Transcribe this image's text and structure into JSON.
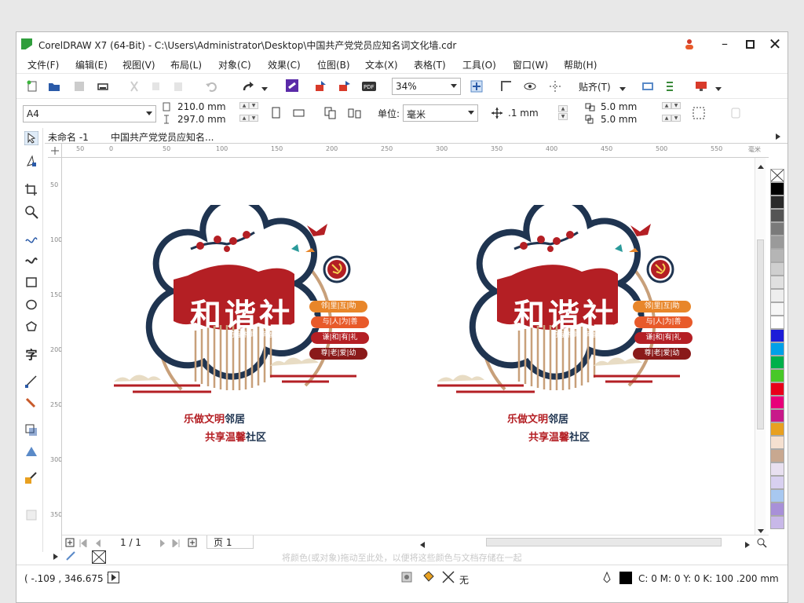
{
  "window": {
    "title": "CorelDRAW X7 (64-Bit) - C:\\Users\\Administrator\\Desktop\\中国共产党党员应知名词文化墙.cdr"
  },
  "menu": [
    "文件(F)",
    "编辑(E)",
    "视图(V)",
    "布局(L)",
    "对象(C)",
    "效果(C)",
    "位图(B)",
    "文本(X)",
    "表格(T)",
    "工具(O)",
    "窗口(W)",
    "帮助(H)"
  ],
  "toolbar": {
    "zoom": "34%",
    "snap_label": "贴齐(T)"
  },
  "property_bar": {
    "page_size": "A4",
    "width": "210.0 mm",
    "height": "297.0 mm",
    "units_label": "单位:",
    "units_value": "毫米",
    "nudge": ".1 mm",
    "dup_x": "5.0 mm",
    "dup_y": "5.0 mm"
  },
  "doc_tabs": [
    "未命名 -1",
    "中国共产党党员应知名..."
  ],
  "ruler": {
    "h_ticks": [
      "50",
      "0",
      "50",
      "100",
      "150",
      "200",
      "250",
      "300",
      "350",
      "400",
      "450",
      "500",
      "550"
    ],
    "h_unit": "毫米",
    "v_ticks": [
      "50",
      "100",
      "150",
      "200",
      "250",
      "300",
      "350"
    ]
  },
  "design": {
    "main_title": "和谐社区",
    "subtitle": "守望相助 幸福邻里",
    "tags": [
      "邻|里|互|助",
      "与|人|为|善",
      "谦|和|有|礼",
      "尊|老|爱|幼"
    ],
    "slogan1_a": "乐做文明",
    "slogan1_b": "邻居",
    "slogan2_a": "共享温馨",
    "slogan2_b": "社区",
    "colors": {
      "red": "#b41f24",
      "navy": "#1f3450",
      "orange": "#e8862a",
      "tan": "#c8a07a"
    }
  },
  "page_nav": {
    "counter": "1 / 1",
    "page_tab": "页 1"
  },
  "hint_text": "将颜色(或对象)拖动至此处，以便将这些颜色与文档存储在一起",
  "status": {
    "coords": "( -.109 , 346.675 )",
    "fill_label": "无",
    "outline_info": "C: 0 M: 0 Y: 0 K: 100  .200 mm"
  },
  "palette": [
    "#ffffff",
    "#000000",
    "#2a2a2a",
    "#555555",
    "#7a7a7a",
    "#9a9a9a",
    "#b5b5b5",
    "#cfcfcf",
    "#e0e0e0",
    "#eeeeee",
    "#f6f6f6",
    "#ffffff",
    "#1d1dd8",
    "#00a0e8",
    "#00b04a",
    "#48c828",
    "#e8001a",
    "#e8007a",
    "#c81a8a",
    "#e8a020",
    "#f5e0d0",
    "#c8a890",
    "#e8e0f0",
    "#d8d0f0",
    "#a8c8f0",
    "#a890d8",
    "#c8b8e8"
  ],
  "icons": [
    "app-icon",
    "user-icon",
    "minimize-icon",
    "maximize-icon",
    "close-icon",
    "new-doc-icon",
    "open-icon",
    "save-icon",
    "print-icon",
    "undo-icon",
    "redo-icon",
    "import-icon",
    "export-icon",
    "pdf-icon",
    "pick-tool-icon",
    "shape-tool-icon",
    "crop-tool-icon",
    "zoom-tool-icon",
    "freehand-tool-icon",
    "rectangle-tool-icon",
    "ellipse-tool-icon",
    "polygon-tool-icon",
    "text-tool-icon",
    "dimension-tool-icon",
    "connector-tool-icon",
    "shadow-tool-icon",
    "transparency-tool-icon",
    "eyedropper-tool-icon",
    "fill-tool-icon",
    "party-emblem-icon",
    "bird-icon"
  ]
}
